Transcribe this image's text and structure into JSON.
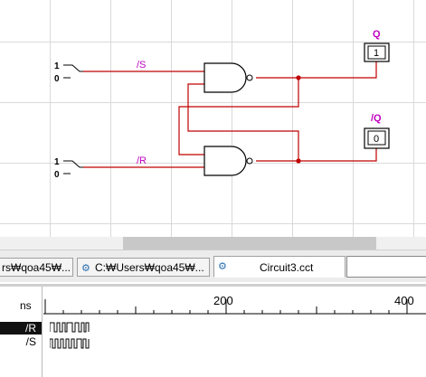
{
  "circuit": {
    "input_r": {
      "label": "/R",
      "hi": "1",
      "lo": "0"
    },
    "input_s": {
      "label": "/S",
      "hi": "1",
      "lo": "0"
    },
    "output_q": {
      "label": "Q",
      "value": "1"
    },
    "output_nq": {
      "label": "/Q",
      "value": "0"
    },
    "wire_color": "#c00000"
  },
  "tabs": [
    {
      "label": "rs₩qoa45₩..."
    },
    {
      "label": "C:₩Users₩qoa45₩..."
    },
    {
      "label": "Circuit3.cct"
    },
    {
      "label": ""
    }
  ],
  "waveform": {
    "unit": "ns",
    "ticks": [
      "200",
      "400"
    ],
    "signals": [
      {
        "name": "/R",
        "selected": true
      },
      {
        "name": "/S",
        "selected": false
      }
    ]
  }
}
